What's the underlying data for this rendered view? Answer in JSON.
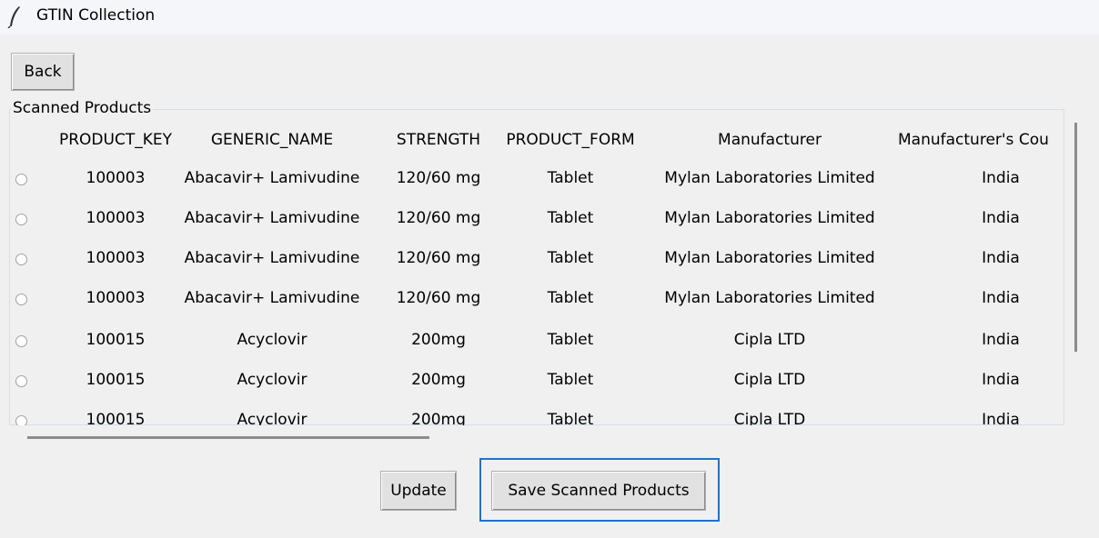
{
  "window": {
    "title": "GTIN Collection"
  },
  "buttons": {
    "back": "Back",
    "update": "Update",
    "save": "Save Scanned Products"
  },
  "group": {
    "label": "Scanned Products"
  },
  "table": {
    "headers": [
      "PRODUCT_KEY",
      "GENERIC_NAME",
      "STRENGTH",
      "PRODUCT_FORM",
      "Manufacturer",
      "Manufacturer's Cou"
    ],
    "rows": [
      [
        "100003",
        "Abacavir+ Lamivudine",
        "120/60 mg",
        "Tablet",
        "Mylan Laboratories Limited",
        "India"
      ],
      [
        "100003",
        "Abacavir+ Lamivudine",
        "120/60 mg",
        "Tablet",
        "Mylan Laboratories Limited",
        "India"
      ],
      [
        "100003",
        "Abacavir+ Lamivudine",
        "120/60 mg",
        "Tablet",
        "Mylan Laboratories Limited",
        "India"
      ],
      [
        "100003",
        "Abacavir+ Lamivudine",
        "120/60 mg",
        "Tablet",
        "Mylan Laboratories Limited",
        "India"
      ],
      [
        "100015",
        "Acyclovir",
        "200mg",
        "Tablet",
        "Cipla LTD",
        "India"
      ],
      [
        "100015",
        "Acyclovir",
        "200mg",
        "Tablet",
        "Cipla LTD",
        "India"
      ],
      [
        "100015",
        "Acyclovir",
        "200mg",
        "Tablet",
        "Cipla LTD",
        "India"
      ]
    ]
  },
  "icons": {
    "window": "feather-icon"
  },
  "colors": {
    "focus_border": "#1e73c8",
    "background": "#f0f0f0"
  }
}
